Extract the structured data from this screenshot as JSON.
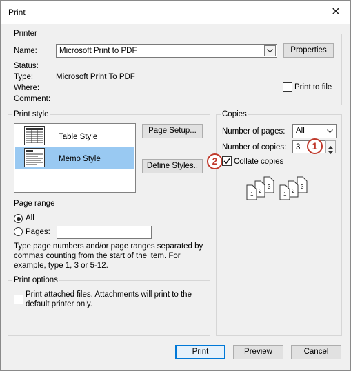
{
  "window": {
    "title": "Print"
  },
  "printer": {
    "section": "Printer",
    "name_label": "Name:",
    "name_value": "Microsoft Print to PDF",
    "properties_button": "Properties",
    "status_label": "Status:",
    "type_label": "Type:",
    "type_value": "Microsoft Print To PDF",
    "where_label": "Where:",
    "comment_label": "Comment:",
    "print_to_file": "Print to file"
  },
  "print_style": {
    "section": "Print style",
    "items": [
      {
        "label": "Table Style"
      },
      {
        "label": "Memo Style"
      }
    ],
    "page_setup_button": "Page Setup...",
    "define_styles_button": "Define Styles.."
  },
  "copies": {
    "section": "Copies",
    "num_pages_label": "Number of pages:",
    "num_pages_value": "All",
    "num_copies_label": "Number of copies:",
    "num_copies_value": "3",
    "collate_label": "Collate copies",
    "collate_checked": true,
    "badge1": "1",
    "badge2": "2",
    "collate_icon": {
      "stack_labels": [
        "1",
        "2",
        "3"
      ]
    }
  },
  "page_range": {
    "section": "Page range",
    "all_label": "All",
    "pages_label": "Pages:",
    "hint": "Type page numbers and/or page ranges separated by commas counting from the start of the item.  For example, type 1, 3 or 5-12."
  },
  "print_options": {
    "section": "Print options",
    "attached_label": "Print attached files.  Attachments will print to the default printer only."
  },
  "footer": {
    "print_button": "Print",
    "preview_button": "Preview",
    "cancel_button": "Cancel"
  },
  "colors": {
    "accent": "#0078d7",
    "selection": "#99c9f2",
    "badge": "#c0392b"
  }
}
